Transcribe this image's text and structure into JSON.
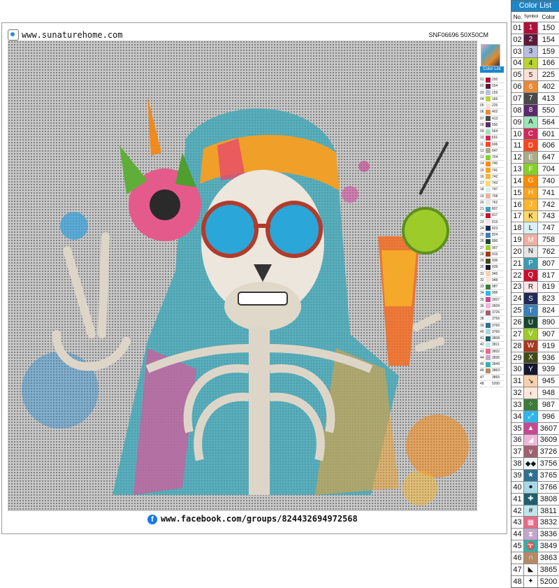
{
  "header": {
    "site": "www.sunaturehome.com",
    "sku": "SNF06696 50X50CM"
  },
  "footer": {
    "facebook_icon": "facebook-icon",
    "link": "www.facebook.com/groups/824432694972568"
  },
  "legend": {
    "title": "Color List",
    "col_no": "No.",
    "col_symbol": "Symbol",
    "col_color": "Color",
    "rows": [
      {
        "no": "01",
        "symbol": "1",
        "color": "150",
        "swatch": "#b0103a"
      },
      {
        "no": "02",
        "symbol": "2",
        "color": "154",
        "swatch": "#5a1a3a"
      },
      {
        "no": "03",
        "symbol": "3",
        "color": "159",
        "swatch": "#b9bfe0"
      },
      {
        "no": "04",
        "symbol": "4",
        "color": "166",
        "swatch": "#b9d433"
      },
      {
        "no": "05",
        "symbol": "5",
        "color": "225",
        "swatch": "#fbe0d6"
      },
      {
        "no": "06",
        "symbol": "6",
        "color": "402",
        "swatch": "#e88a3a"
      },
      {
        "no": "07",
        "symbol": "7",
        "color": "413",
        "swatch": "#4a4a4a"
      },
      {
        "no": "08",
        "symbol": "8",
        "color": "550",
        "swatch": "#5a2a6a"
      },
      {
        "no": "09",
        "symbol": "A",
        "color": "564",
        "swatch": "#9fe3b8"
      },
      {
        "no": "10",
        "symbol": "C",
        "color": "601",
        "swatch": "#d1285a"
      },
      {
        "no": "11",
        "symbol": "D",
        "color": "606",
        "swatch": "#f5451f"
      },
      {
        "no": "12",
        "symbol": "E",
        "color": "647",
        "swatch": "#a9ab8a"
      },
      {
        "no": "13",
        "symbol": "F",
        "color": "704",
        "swatch": "#86d02a"
      },
      {
        "no": "14",
        "symbol": "G",
        "color": "740",
        "swatch": "#ff8a00"
      },
      {
        "no": "15",
        "symbol": "H",
        "color": "741",
        "swatch": "#ffa31a"
      },
      {
        "no": "16",
        "symbol": "J",
        "color": "742",
        "swatch": "#ffb52e"
      },
      {
        "no": "17",
        "symbol": "K",
        "color": "743",
        "swatch": "#ffd86a"
      },
      {
        "no": "18",
        "symbol": "L",
        "color": "747",
        "swatch": "#d8f0f4"
      },
      {
        "no": "19",
        "symbol": "M",
        "color": "758",
        "swatch": "#eeb0a0"
      },
      {
        "no": "20",
        "symbol": "N",
        "color": "762",
        "swatch": "#e6e6e6"
      },
      {
        "no": "21",
        "symbol": "P",
        "color": "807",
        "swatch": "#3f9ab0"
      },
      {
        "no": "22",
        "symbol": "Q",
        "color": "817",
        "swatch": "#c8102e"
      },
      {
        "no": "23",
        "symbol": "R",
        "color": "819",
        "swatch": "#fde6e6"
      },
      {
        "no": "24",
        "symbol": "S",
        "color": "823",
        "swatch": "#1f2a55"
      },
      {
        "no": "25",
        "symbol": "T",
        "color": "824",
        "swatch": "#3b7fb8"
      },
      {
        "no": "26",
        "symbol": "U",
        "color": "890",
        "swatch": "#17462f"
      },
      {
        "no": "27",
        "symbol": "V",
        "color": "907",
        "swatch": "#9ccb2a"
      },
      {
        "no": "28",
        "symbol": "W",
        "color": "919",
        "swatch": "#a5391f"
      },
      {
        "no": "29",
        "symbol": "X",
        "color": "936",
        "swatch": "#424a1c"
      },
      {
        "no": "30",
        "symbol": "Y",
        "color": "939",
        "swatch": "#17172f"
      },
      {
        "no": "31",
        "symbol": "↘",
        "color": "945",
        "swatch": "#f6d1ae"
      },
      {
        "no": "32",
        "symbol": "‹",
        "color": "948",
        "swatch": "#fde7db"
      },
      {
        "no": "33",
        "symbol": "⁘",
        "color": "987",
        "swatch": "#3f7a3a"
      },
      {
        "no": "34",
        "symbol": "⤢",
        "color": "996",
        "swatch": "#2fb6ea"
      },
      {
        "no": "35",
        "symbol": "▲",
        "color": "3607",
        "swatch": "#c5498f"
      },
      {
        "no": "36",
        "symbol": "◢",
        "color": "3609",
        "swatch": "#f0b6dc"
      },
      {
        "no": "37",
        "symbol": "∨",
        "color": "3726",
        "swatch": "#a0616f"
      },
      {
        "no": "38",
        "symbol": "◆◆",
        "color": "3756",
        "swatch": "#eef7fa"
      },
      {
        "no": "39",
        "symbol": "★",
        "color": "3765",
        "swatch": "#2f6f8f"
      },
      {
        "no": "40",
        "symbol": "●",
        "color": "3766",
        "swatch": "#a6d8e6"
      },
      {
        "no": "41",
        "symbol": "✚",
        "color": "3808",
        "swatch": "#1e5f6f"
      },
      {
        "no": "42",
        "symbol": "#",
        "color": "3811",
        "swatch": "#bfe6eb"
      },
      {
        "no": "43",
        "symbol": "▦",
        "color": "3832",
        "swatch": "#e56a86"
      },
      {
        "no": "44",
        "symbol": "⧗",
        "color": "3836",
        "swatch": "#c4a6cc"
      },
      {
        "no": "45",
        "symbol": "♈",
        "color": "3849",
        "swatch": "#2fb3ac"
      },
      {
        "no": "46",
        "symbol": "∩",
        "color": "3863",
        "swatch": "#b58a66"
      },
      {
        "no": "47",
        "symbol": "◣",
        "color": "3865",
        "swatch": "#fafafa"
      },
      {
        "no": "48",
        "symbol": "✦",
        "color": "5200",
        "swatch": "#ffffff"
      }
    ]
  }
}
